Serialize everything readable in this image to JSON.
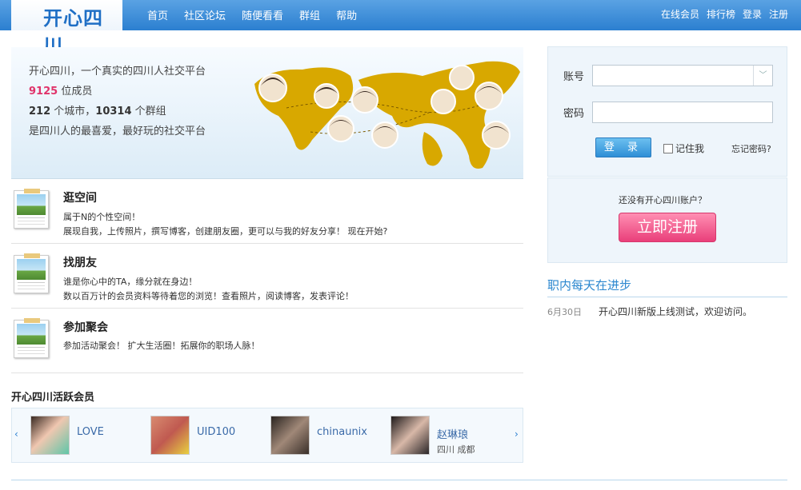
{
  "header": {
    "logo": "开心四川",
    "nav": [
      "首页",
      "社区论坛",
      "随便看看",
      "群组",
      "帮助"
    ],
    "user_nav": [
      "在线会员",
      "排行榜",
      "登录",
      "注册"
    ]
  },
  "banner": {
    "line1": "开心四川，一个真实的四川人社交平台",
    "members_count": "9125",
    "members_suffix": " 位成员",
    "cities_count": "212",
    "cities_suffix": " 个城市，",
    "groups_count": "10314",
    "groups_suffix": " 个群组",
    "line4": "是四川人的最喜爱，最好玩的社交平台"
  },
  "features": [
    {
      "title": "逛空间",
      "lines": [
        "属于N的个性空间！",
        "展现自我，上传照片，撰写博客，创建朋友圈，更可以与我的好友分享！  现在开始?"
      ]
    },
    {
      "title": "找朋友",
      "lines": [
        "谁是你心中的TA，缘分就在身边！",
        "数以百万计的会员资料等待着您的浏览！查看照片，阅读博客，发表评论！"
      ]
    },
    {
      "title": "参加聚会",
      "lines": [
        "参加活动聚会！  扩大生活圈！拓展你的职场人脉！"
      ]
    }
  ],
  "members": {
    "title": "开心四川活跃会员",
    "list": [
      {
        "name": "LOVE",
        "location": ""
      },
      {
        "name": "UID100",
        "location": ""
      },
      {
        "name": "chinaunix",
        "location": ""
      },
      {
        "name": "赵琳琅",
        "location": "四川  成都"
      }
    ],
    "prev_icon": "‹",
    "next_icon": "›"
  },
  "login": {
    "account_label": "账号",
    "password_label": "密码",
    "account_value": "",
    "password_value": "",
    "login_button": "登 录",
    "remember_label": "记住我",
    "forgot_link": "忘记密码?",
    "dropdown_icon": "﹀"
  },
  "register": {
    "question": "还没有开心四川账户？",
    "button": "立即注册"
  },
  "news": {
    "title": "职内每天在进步",
    "items": [
      {
        "date": "6月30日",
        "text": "开心四川新版上线测试，欢迎访问。"
      }
    ]
  }
}
